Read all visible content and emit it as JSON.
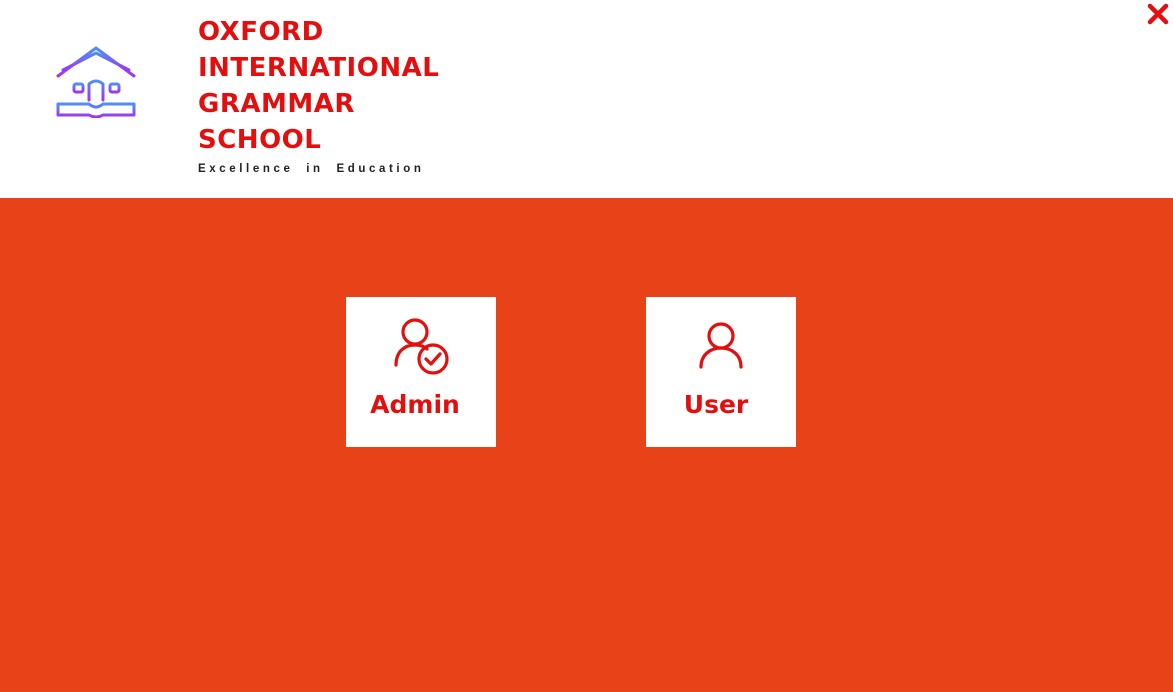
{
  "header": {
    "school_name_lines": [
      "OXFORD",
      "INTERNATIONAL",
      "GRAMMAR",
      "SCHOOL"
    ],
    "tagline": "Excellence in Education",
    "logo_icon": "school-house-book-icon",
    "close_icon": "close-icon"
  },
  "roles": {
    "admin": {
      "label": "Admin",
      "icon": "admin-user-check-icon"
    },
    "user": {
      "label": "User",
      "icon": "user-icon"
    }
  },
  "colors": {
    "background": "#e84218",
    "header_bg": "#ffffff",
    "brand_text": "#e30f0f",
    "tagline_text": "#222222",
    "logo_gradient_start": "#4f8df7",
    "logo_gradient_end": "#a235f0"
  }
}
